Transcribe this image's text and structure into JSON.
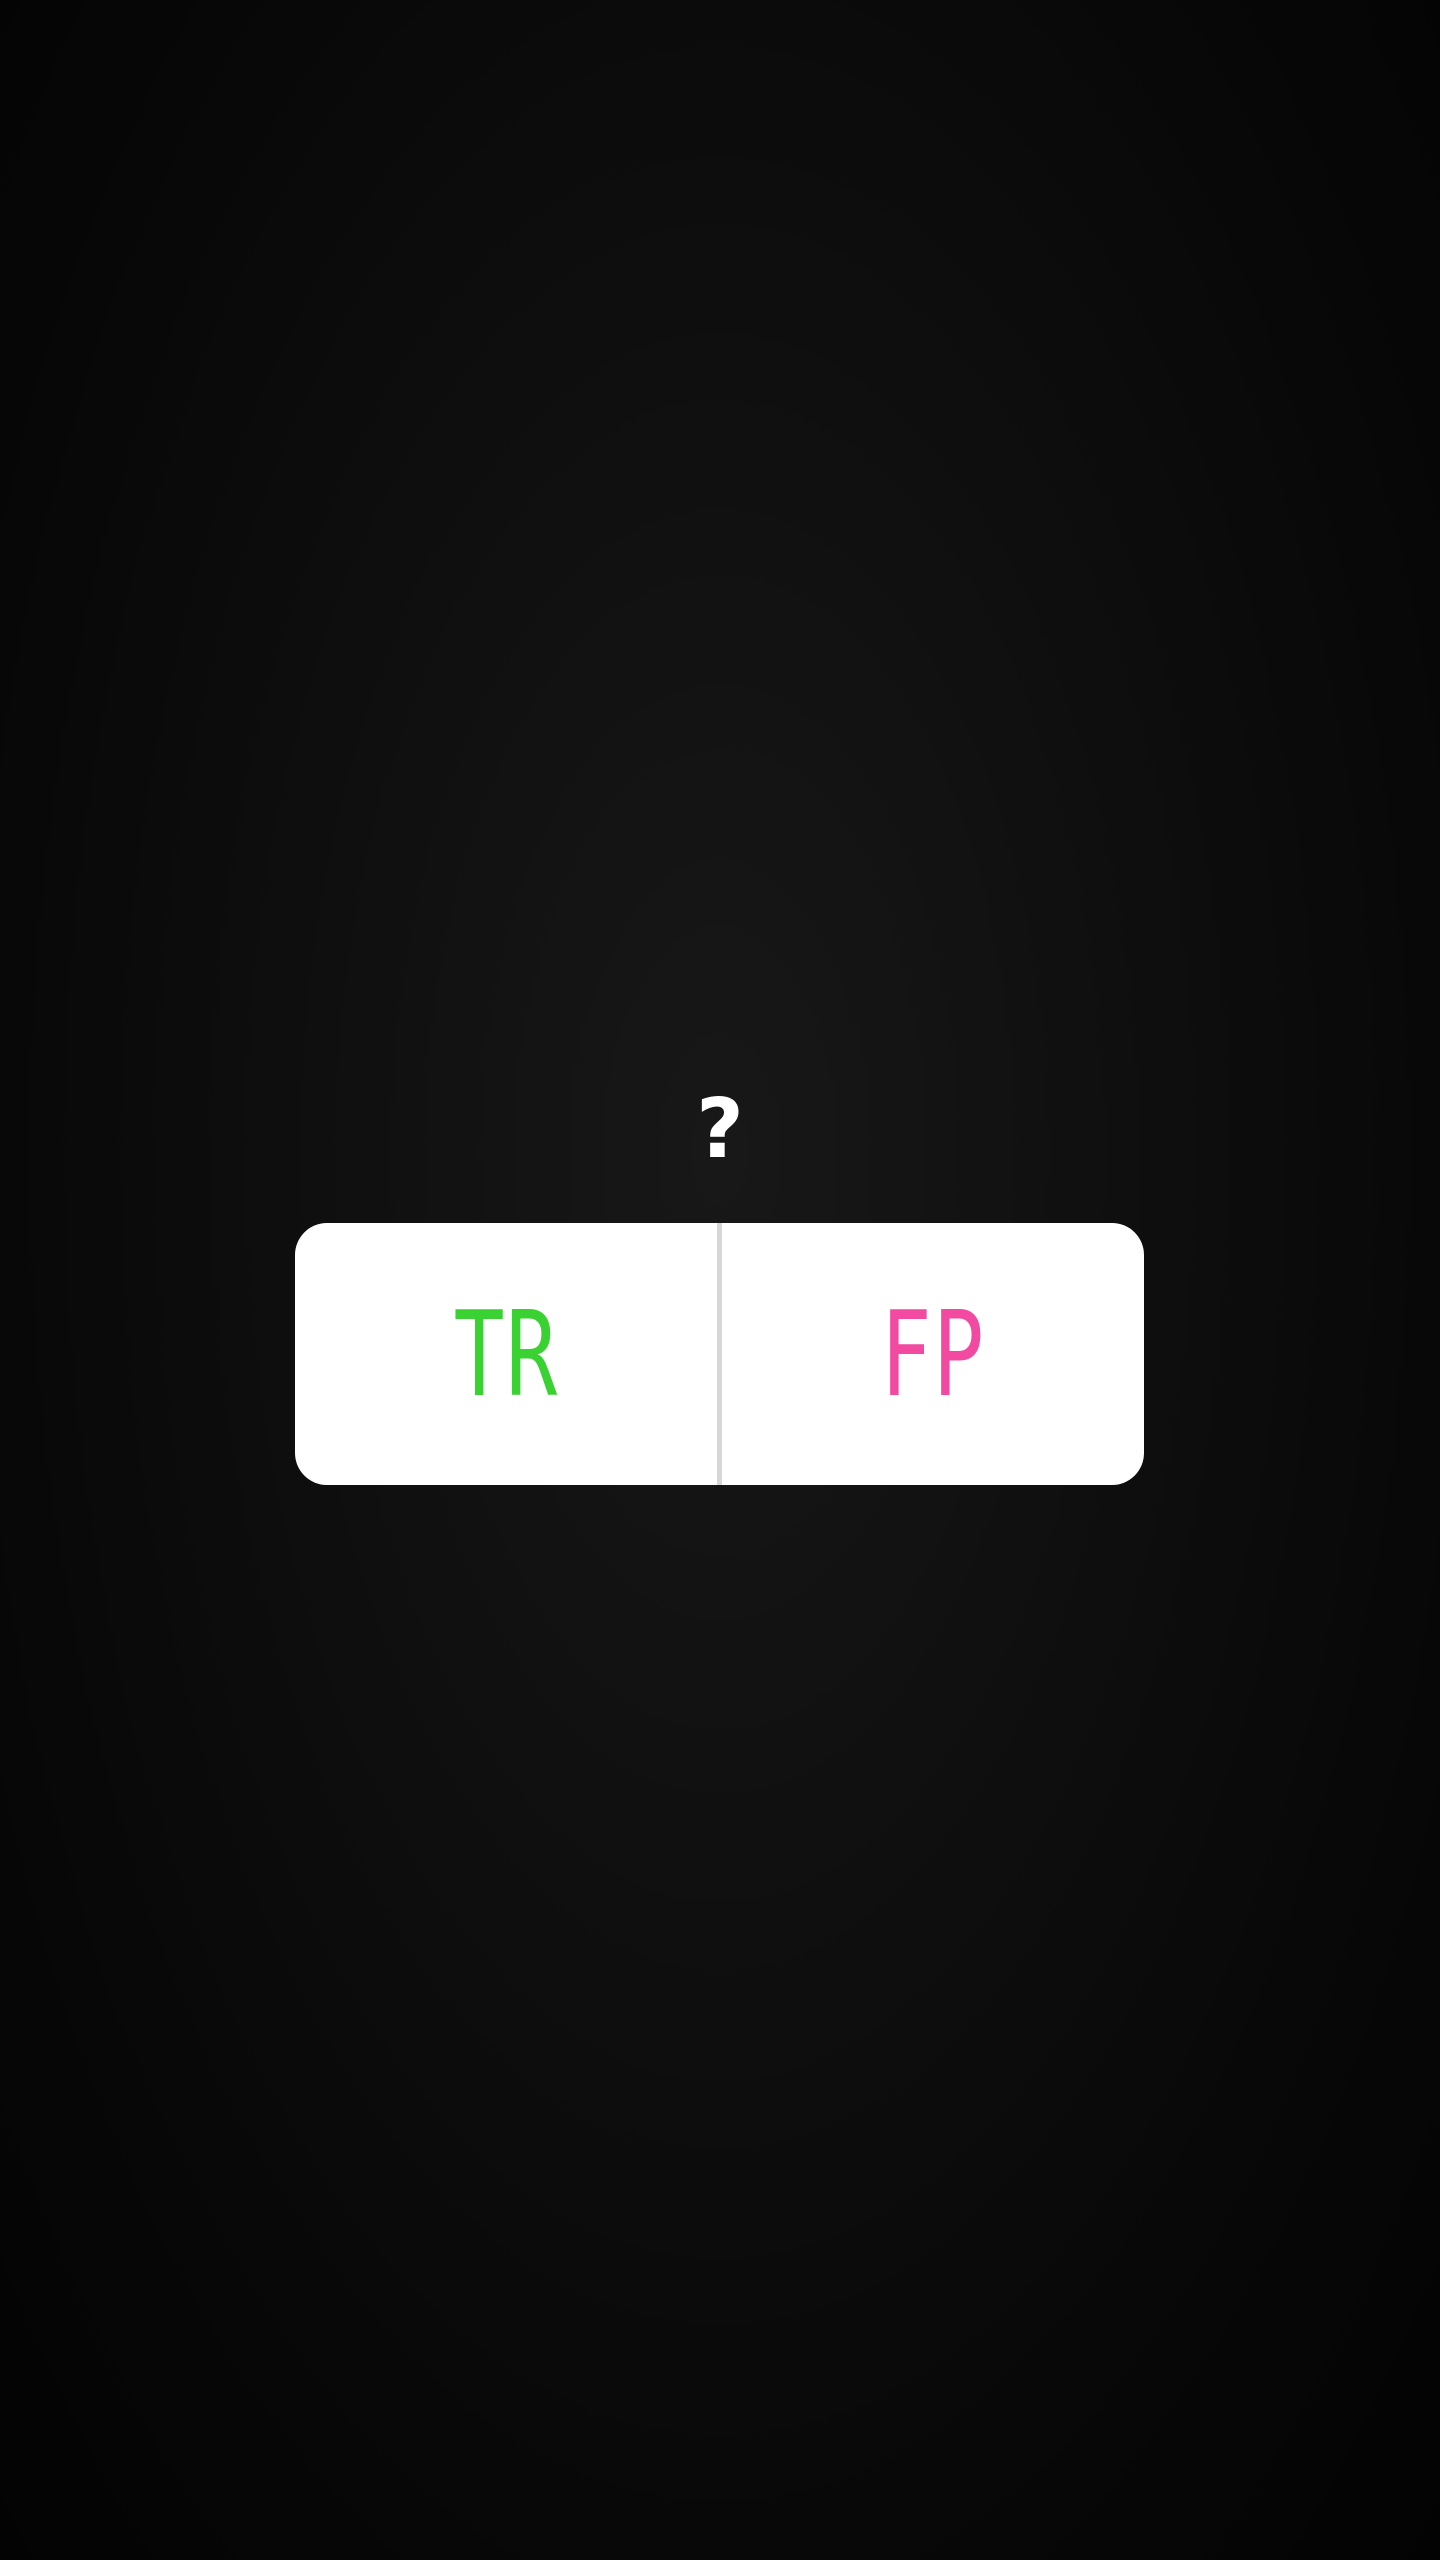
{
  "story_poll": {
    "question": "?",
    "options": [
      {
        "label": "TR",
        "color": "#3ad232"
      },
      {
        "label": "FP",
        "color": "#f14aa0"
      }
    ]
  }
}
